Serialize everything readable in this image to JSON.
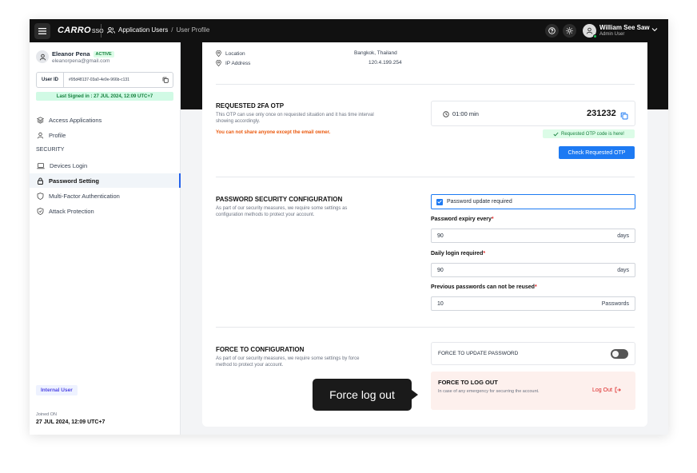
{
  "topbar": {
    "logo": "CARRO",
    "logo_sub": "SSO",
    "breadcrumb_section": "Application Users",
    "breadcrumb_sep": "/",
    "breadcrumb_current": "User Profile",
    "user_name": "William See Saw",
    "user_role": "Admin User"
  },
  "sidebar": {
    "name": "Eleanor Pena",
    "status": "ACTIVE",
    "email": "eleanorpena@gmail.com",
    "user_id_label": "User ID",
    "user_id_value": "#95d48137-03a0-4e9e-966b-c131",
    "last_signed": "Last Signed in : 27 JUL 2024, 12:09 UTC+7",
    "items": [
      {
        "label": "Access Applications",
        "icon": "layers-icon"
      },
      {
        "label": "Profile",
        "icon": "user-icon"
      }
    ],
    "section_label": "SECURITY",
    "security_items": [
      {
        "label": "Devices Login",
        "icon": "laptop-icon"
      },
      {
        "label": "Password Setting",
        "icon": "lock-icon",
        "active": true
      },
      {
        "label": "Multi-Factor Authentication",
        "icon": "shield-icon"
      },
      {
        "label": "Attack Protection",
        "icon": "shield-check-icon"
      }
    ],
    "badge": "Internal User",
    "joined_label": "Joined ON",
    "joined_value": "27 JUL 2024, 12:09 UTC+7"
  },
  "meta": {
    "location_label": "Location",
    "location_value": "Bangkok, Thailand",
    "ip_label": "IP Address",
    "ip_value": "120.4.199.254"
  },
  "otp": {
    "title": "REQUESTED 2FA OTP",
    "desc": "This OTP can use only once on requested situation and it has time interval showing accordingly.",
    "warning": "You can not share anyone except the email owner.",
    "timer": "01:00 min",
    "code": "231232",
    "note": "Requested OTP code is here!",
    "button": "Check Requested OTP"
  },
  "password": {
    "title": "PASSWORD SECURITY CONFIGURATION",
    "desc": "As part of our security measures, we require some settings as configuration methods to protect your account.",
    "checkbox_label": "Password update required",
    "fields": [
      {
        "label": "Password expiry every",
        "value": "90",
        "unit": "days"
      },
      {
        "label": "Daily login required",
        "value": "90",
        "unit": "days"
      },
      {
        "label": "Previous passwords can not be reused",
        "value": "10",
        "unit": "Passwords"
      }
    ],
    "required_mark": "*"
  },
  "force": {
    "title": "FORCE TO CONFIGURATION",
    "desc": "As part of our security measures, we require some settings by force method to protect your account.",
    "update_label": "FORCE TO UPDATE PASSWORD",
    "logout_title": "FORCE TO LOG OUT",
    "logout_desc": "In case of any emergency for securring the account.",
    "logout_button": "Log Out",
    "tooltip": "Force log out"
  },
  "colors": {
    "accent": "#1d7af3",
    "topbar": "#111111",
    "danger": "#dc2626",
    "success": "#15803d"
  }
}
